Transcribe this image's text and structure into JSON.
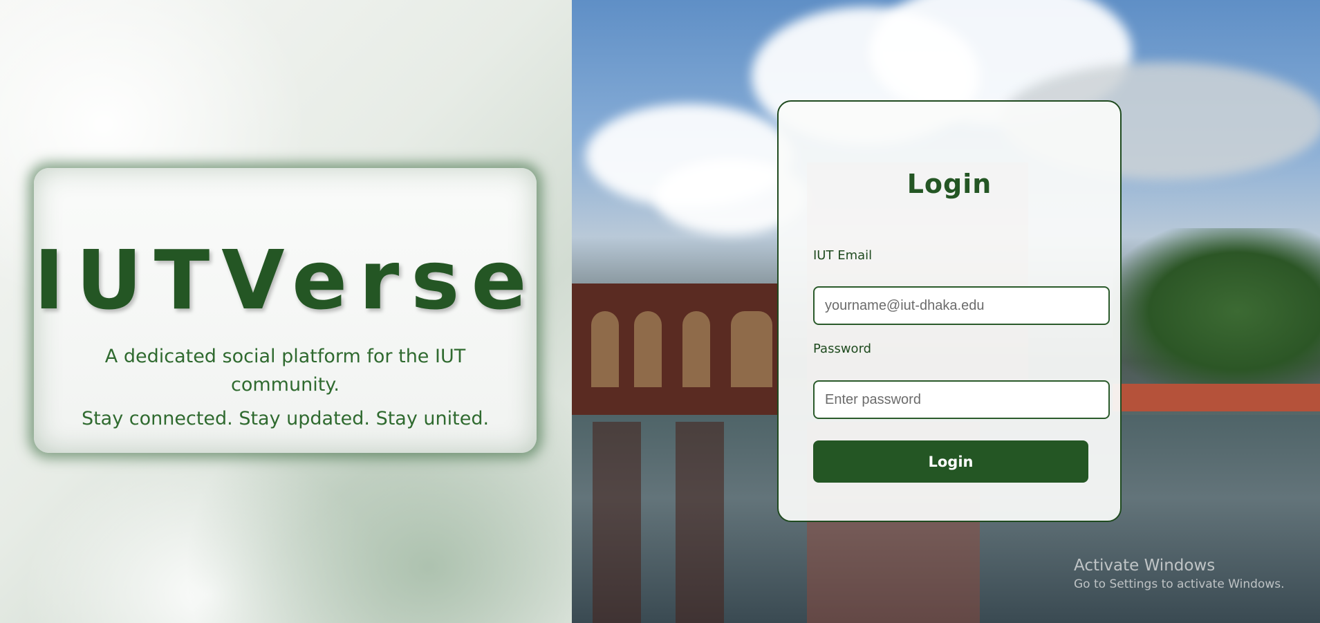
{
  "brand": {
    "title": "IUTVerse",
    "description": "A dedicated social platform for the IUT community.",
    "tagline": "Stay connected. Stay updated. Stay united."
  },
  "login": {
    "heading": "Login",
    "email_label": "IUT Email",
    "email_placeholder": "yourname@iut-dhaka.edu",
    "email_value": "",
    "password_label": "Password",
    "password_placeholder": "Enter password",
    "password_value": "",
    "submit_label": "Login"
  },
  "watermark": {
    "title": "Activate Windows",
    "subtitle": "Go to Settings to activate Windows."
  },
  "colors": {
    "brand_green": "#245624",
    "dark_green": "#1f4a1f"
  }
}
